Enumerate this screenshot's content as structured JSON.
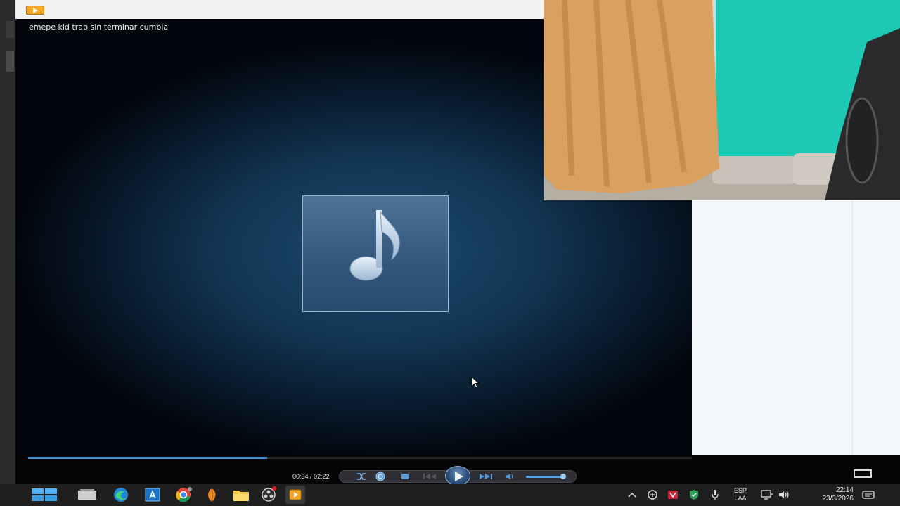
{
  "player": {
    "media_title": "emepe kid trap sin terminar cumbia",
    "time_current": "00:34",
    "time_total": "02:22",
    "time_separator": " / ",
    "progress_fraction": 0.36,
    "volume_fraction": 0.95,
    "state": "paused",
    "accent_color": "#3f8fd4"
  },
  "icons": {
    "now_playing_art": "music-note-icon",
    "controls": [
      "shuffle-icon",
      "repeat-icon",
      "stop-icon",
      "previous-icon",
      "play-icon",
      "next-icon",
      "mute-icon"
    ]
  },
  "taskbar": {
    "apps": [
      "start-icon",
      "task-view-icon",
      "edge-icon",
      "store-icon",
      "chrome-icon",
      "fl-studio-icon",
      "file-explorer-icon",
      "obs-icon",
      "media-player-icon"
    ],
    "language_line1": "ESP",
    "language_line2": "LAA",
    "time": "22:14",
    "date": "23/3/2026"
  }
}
